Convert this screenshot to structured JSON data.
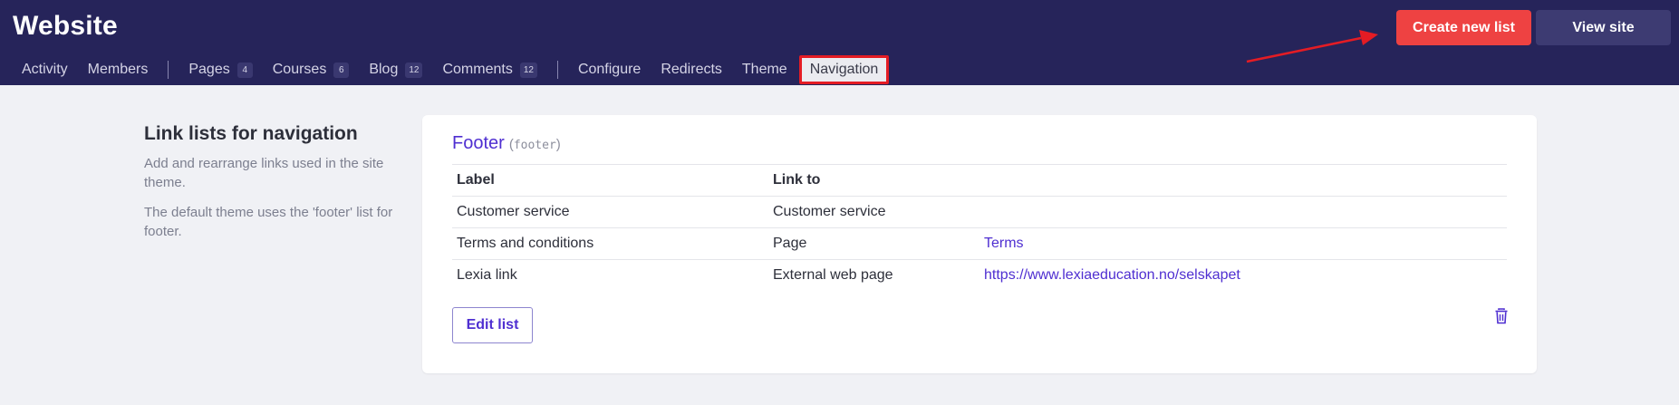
{
  "header": {
    "title": "Website",
    "create_label": "Create new list",
    "view_label": "View site"
  },
  "nav": {
    "activity": "Activity",
    "members": "Members",
    "pages": "Pages",
    "pages_count": "4",
    "courses": "Courses",
    "courses_count": "6",
    "blog": "Blog",
    "blog_count": "12",
    "comments": "Comments",
    "comments_count": "12",
    "configure": "Configure",
    "redirects": "Redirects",
    "theme": "Theme",
    "navigation": "Navigation"
  },
  "intro": {
    "heading": "Link lists for navigation",
    "p1": "Add and rearrange links used in the site theme.",
    "p2": "The default theme uses the 'footer' list for footer."
  },
  "list": {
    "name": "Footer",
    "slug_open": "(",
    "slug": "footer",
    "slug_close": ")",
    "col_label": "Label",
    "col_link": "Link to",
    "rows": [
      {
        "label": "Customer service",
        "type": "Customer service",
        "target": ""
      },
      {
        "label": "Terms and conditions",
        "type": "Page",
        "target": "Terms"
      },
      {
        "label": "Lexia link",
        "type": "External web page",
        "target": "https://www.lexiaeducation.no/selskapet"
      }
    ],
    "edit_label": "Edit list"
  },
  "icons": {
    "trash": "trash-icon",
    "annotation": "red-arrow"
  },
  "colors": {
    "header_bg": "#26245a",
    "primary": "#ee4242",
    "accent": "#4f2fd1",
    "highlight": "#e41c24"
  }
}
